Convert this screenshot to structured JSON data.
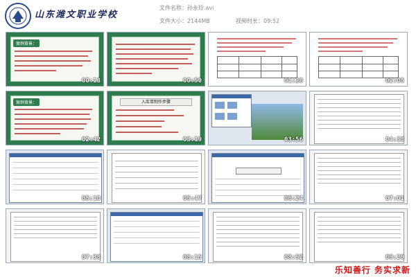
{
  "header": {
    "school_name": "山东潍文职业学校",
    "file_name": "文件名称：孙永玲.avi",
    "file_size": "文件大小：2144MB",
    "duration": "视频时长：09:52"
  },
  "thumbnails": [
    {
      "timestamp": "00:13"
    },
    {
      "timestamp": "00:50"
    },
    {
      "timestamp": "01:28"
    },
    {
      "timestamp": "02:05"
    },
    {
      "timestamp": "02:42"
    },
    {
      "timestamp": "03:19"
    },
    {
      "timestamp": "03:56"
    },
    {
      "timestamp": "04:33"
    },
    {
      "timestamp": "05:10"
    },
    {
      "timestamp": "05:47"
    },
    {
      "timestamp": "06:24"
    },
    {
      "timestamp": "07:01"
    },
    {
      "timestamp": "07:38"
    },
    {
      "timestamp": "08:15"
    },
    {
      "timestamp": "08:52"
    },
    {
      "timestamp": "09:29"
    }
  ],
  "slides": {
    "case_badge": "案例背景：",
    "process_title": "入库单制作步骤"
  },
  "footer": {
    "motto": "乐知善行  务实求新"
  },
  "colors": {
    "slide_green": "#2f7d4e",
    "text_red": "#c23a3a",
    "motto_red": "#d01818"
  }
}
